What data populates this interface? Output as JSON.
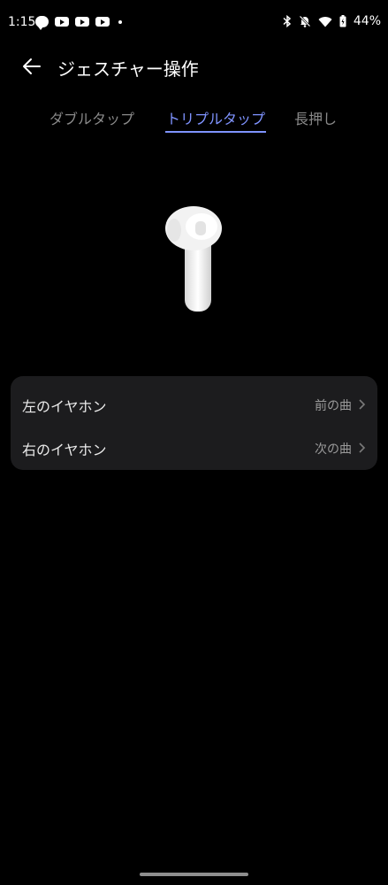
{
  "status_bar": {
    "time": "1:15",
    "battery_percent": "44%",
    "icons_left": [
      "line-icon",
      "youtube-icon",
      "youtube-icon",
      "youtube-icon",
      "dot-icon"
    ],
    "icons_right": [
      "bluetooth-icon",
      "mute-icon",
      "wifi-icon",
      "battery-charging-icon"
    ]
  },
  "header": {
    "title": "ジェスチャー操作"
  },
  "tabs": [
    {
      "label": "ダブルタップ",
      "active": false
    },
    {
      "label": "トリプルタップ",
      "active": true
    },
    {
      "label": "長押し",
      "active": false
    }
  ],
  "settings": {
    "rows": [
      {
        "label": "左のイヤホン",
        "value": "前の曲"
      },
      {
        "label": "右のイヤホン",
        "value": "次の曲"
      }
    ]
  },
  "colors": {
    "accent": "#7f93ff",
    "background": "#000000",
    "card": "#1c1c1e"
  }
}
